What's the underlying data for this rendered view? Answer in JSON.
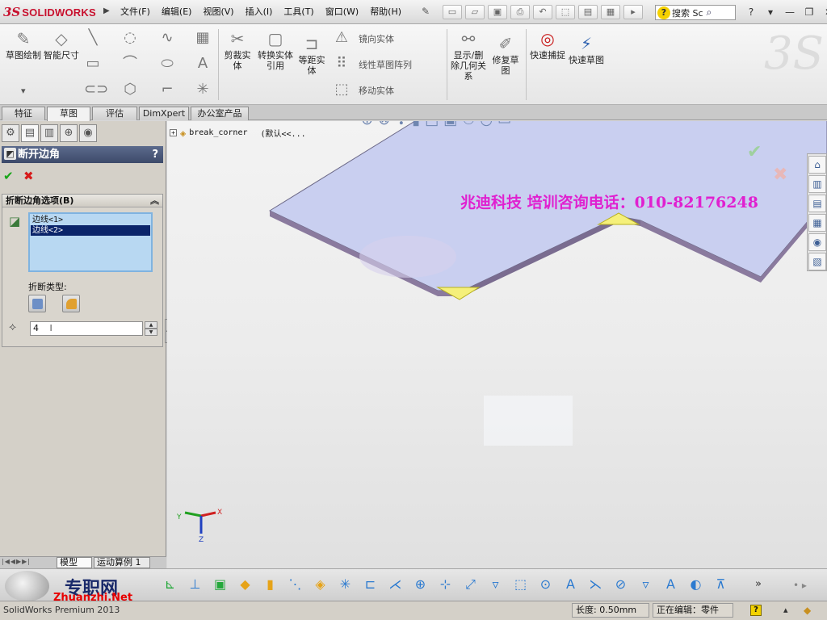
{
  "app": {
    "brand": "SOLIDWORKS",
    "brand_prefix": "3S",
    "menu": [
      "文件(F)",
      "编辑(E)",
      "视图(V)",
      "插入(I)",
      "工具(T)",
      "窗口(W)",
      "帮助(H)"
    ],
    "search_label": "搜索 Sc",
    "window_controls": [
      "?",
      "▾",
      "—",
      "❐",
      "✕"
    ]
  },
  "ribbon": {
    "tools": {
      "sketch": "草图绘制",
      "smart_dim": "智能尺寸",
      "trim": "剪裁实体",
      "convert": "转换实体引用",
      "offset": "等距实体",
      "mirror": "镜向实体",
      "linear_pattern": "线性草图阵列",
      "move": "移动实体",
      "display_relations": "显示/删除几何关系",
      "repair": "修复草图",
      "quick_snaps": "快速捕捉",
      "rapid_sketch": "快速草图"
    }
  },
  "command_tabs": [
    "特征",
    "草图",
    "评估",
    "DimXpert",
    "办公室产品"
  ],
  "command_tab_active": "草图",
  "property_manager": {
    "title": "断开边角",
    "help": "?",
    "group_title": "折断边角选项(B)",
    "edges": [
      "边线<1>",
      "边线<2>"
    ],
    "selected_edge_index": 1,
    "break_type_label": "折断类型:",
    "distance_value": "4",
    "distance_caret": "I"
  },
  "viewport": {
    "tree_root": "break_corner",
    "tree_config": "(默认<<...",
    "watermark": "兆迪科技    培训咨询电话：010-82176248",
    "axis_labels": {
      "x": "X",
      "y": "Y",
      "z": "Z"
    },
    "part_colors": {
      "top_face": "#c9cff0",
      "edge_side": "#8a7a9e",
      "highlight": "#f5f07a"
    }
  },
  "bottom_tabs": [
    "模型",
    "运动算例 1"
  ],
  "bottom_toolbar": {
    "brand": "专职网",
    "brand_sub": "Zhuanzhi.Net",
    "more": "»"
  },
  "status": {
    "left": "SolidWorks Premium 2013",
    "length": "长度: 0.50mm",
    "editing": "正在编辑：零件",
    "help": "?"
  }
}
